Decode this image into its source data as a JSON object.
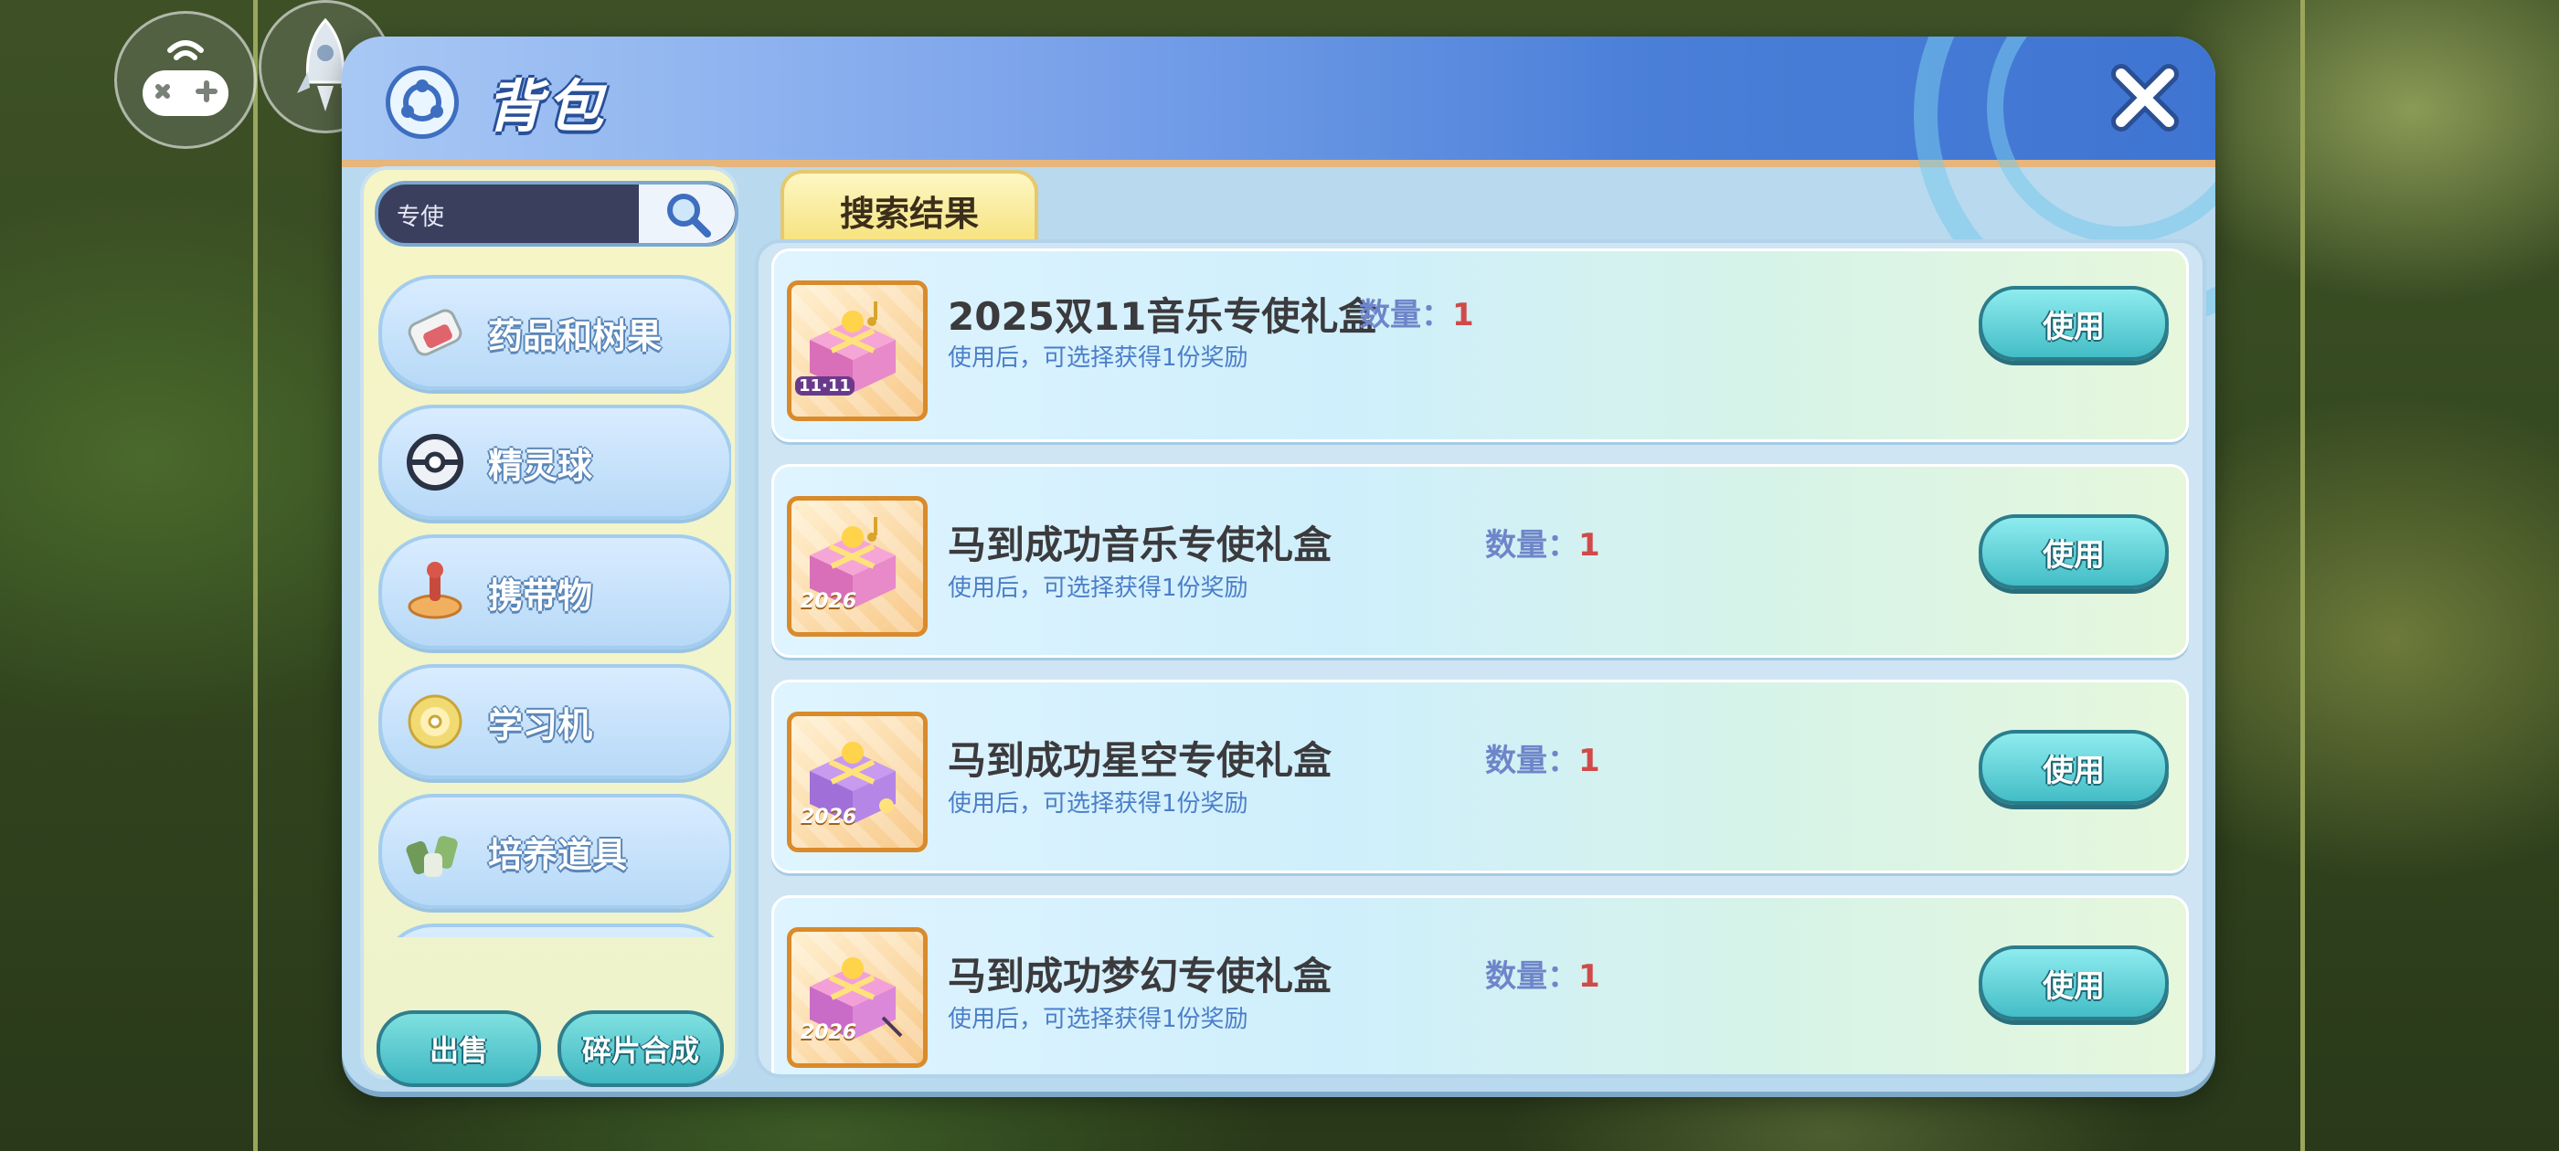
{
  "window": {
    "title": "背包"
  },
  "hud": {
    "gamepad_icon": "gamepad-icon",
    "rocket_icon": "rocket-icon"
  },
  "sidebar": {
    "search": {
      "value": "专使",
      "placeholder": ""
    },
    "categories": [
      {
        "label": "药品和树果",
        "icon": "potion-icon"
      },
      {
        "label": "精灵球",
        "icon": "pokeball-icon"
      },
      {
        "label": "携带物",
        "icon": "held-item-icon"
      },
      {
        "label": "学习机",
        "icon": "disc-icon"
      },
      {
        "label": "培养道具",
        "icon": "training-item-icon"
      }
    ],
    "sell_label": "出售",
    "synth_label": "碎片合成"
  },
  "tabs": {
    "search_results": "搜索结果"
  },
  "items": [
    {
      "name": "2025双11音乐专使礼盒",
      "desc": "使用后，可选择获得1份奖励",
      "qty_label": "数量：",
      "qty": "1",
      "use": "使用",
      "badge": "11·11"
    },
    {
      "name": "马到成功音乐专使礼盒",
      "desc": "使用后，可选择获得1份奖励",
      "qty_label": "数量：",
      "qty": "1",
      "use": "使用",
      "badge": "2026"
    },
    {
      "name": "马到成功星空专使礼盒",
      "desc": "使用后，可选择获得1份奖励",
      "qty_label": "数量：",
      "qty": "1",
      "use": "使用",
      "badge": "2026"
    },
    {
      "name": "马到成功梦幻专使礼盒",
      "desc": "使用后，可选择获得1份奖励",
      "qty_label": "数量：",
      "qty": "1",
      "use": "使用",
      "badge": "2026"
    }
  ],
  "colors": {
    "accent": "#43bdc6",
    "header": "#4a7fd8",
    "qty_value": "#d04a4a",
    "desc_text": "#4b7ec8"
  }
}
